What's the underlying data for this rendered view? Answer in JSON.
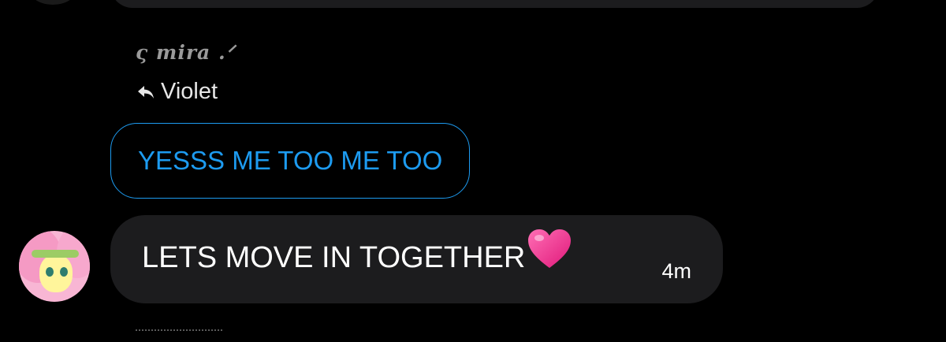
{
  "thread": {
    "reply_block": {
      "sender_name": "ς mira .ᐟ",
      "reply_to_label": "Violet",
      "message": "YESSS ME TOO ME TOO"
    },
    "message": {
      "text": "LETS MOVE IN TOGETHER",
      "emoji": "heart-emoji",
      "time": "4m"
    }
  },
  "colors": {
    "background": "#000000",
    "bubble": "#1c1c1e",
    "accent": "#1d9bf0",
    "sender": "#9a9a9a",
    "heart": "#f43f8f"
  }
}
